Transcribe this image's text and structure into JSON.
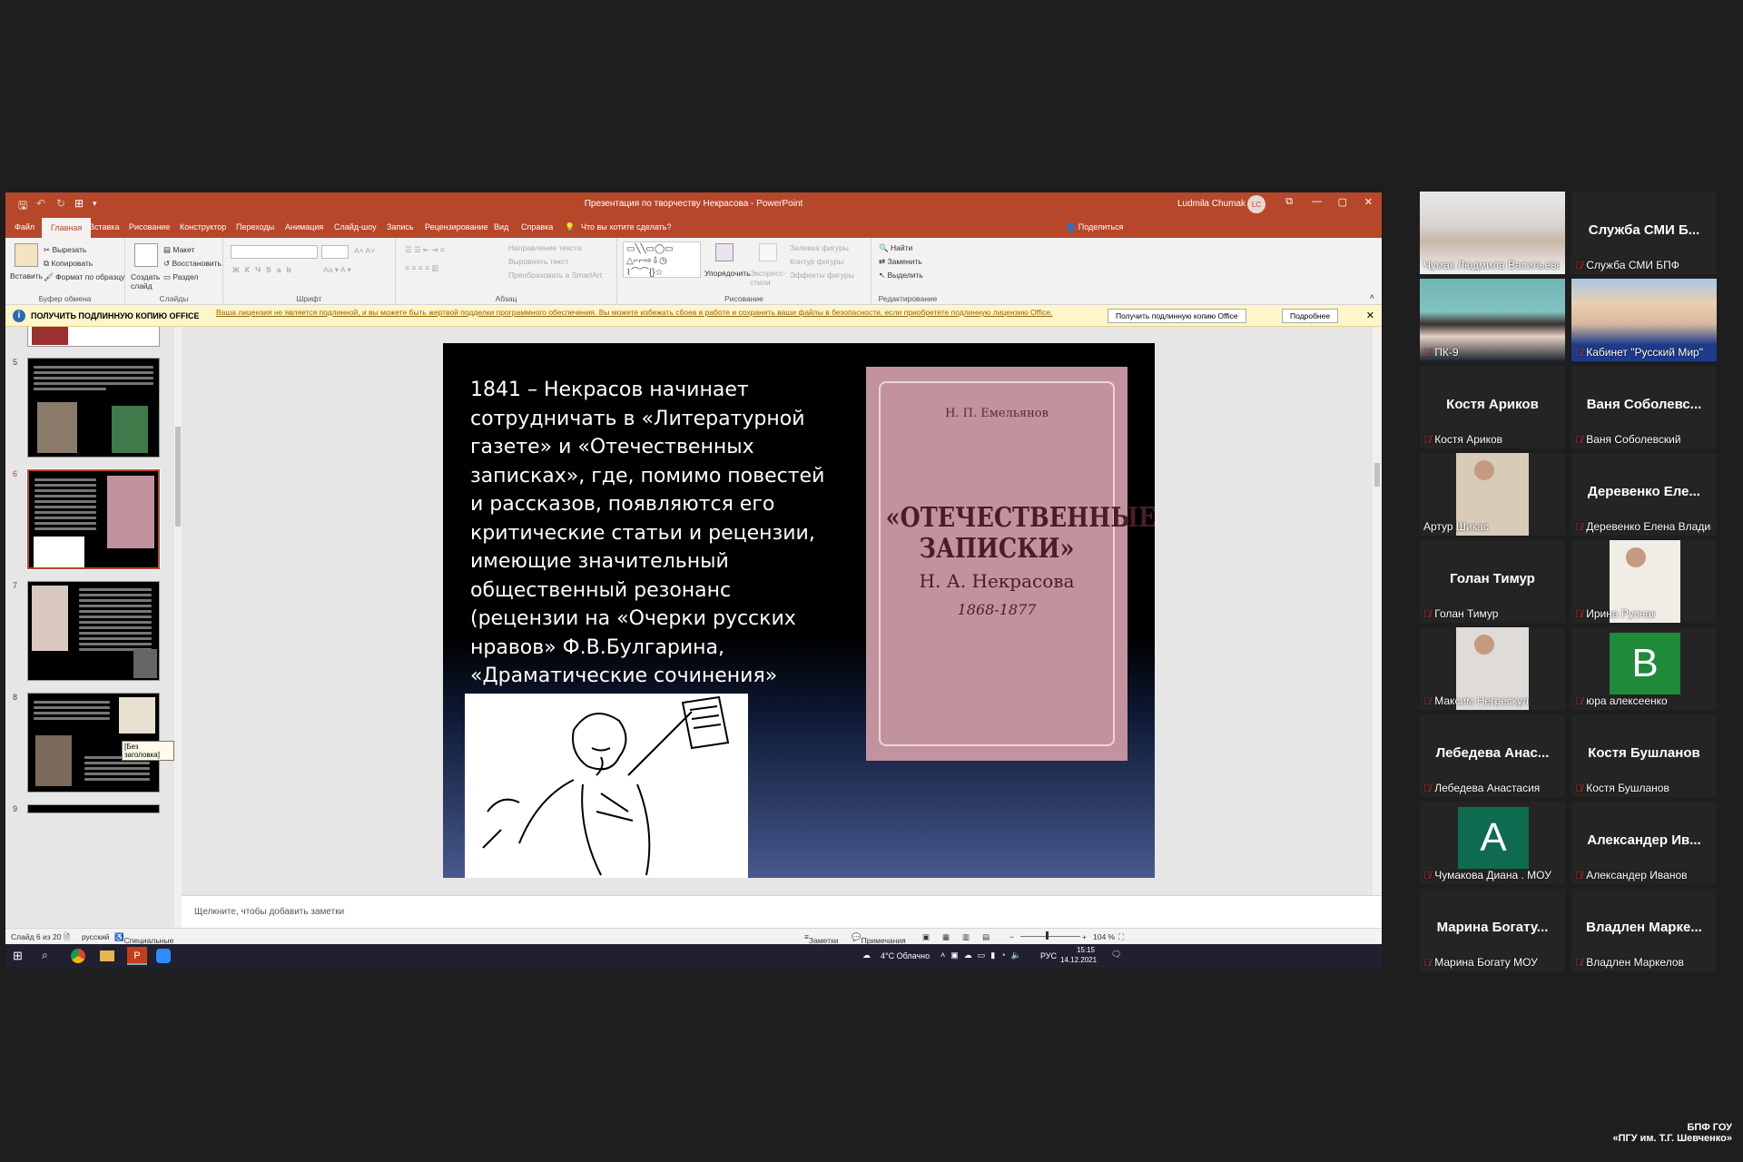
{
  "ppt": {
    "window_title": "Презентация по творчеству Некрасова - PowerPoint",
    "user_name": "Ludmila Chumak",
    "user_initials": "LC",
    "menu": [
      "Файл",
      "Главная",
      "Вставка",
      "Рисование",
      "Конструктор",
      "Переходы",
      "Анимация",
      "Слайд-шоу",
      "Запись",
      "Рецензирование",
      "Вид",
      "Справка"
    ],
    "tell_me": "Что вы хотите сделать?",
    "share": "Поделиться",
    "ribbon": {
      "clipboard": {
        "label": "Буфер обмена",
        "paste": "Вставить",
        "cut": "Вырезать",
        "copy": "Копировать",
        "format": "Формат по образцу"
      },
      "slides": {
        "label": "Слайды",
        "new": "Создать слайд",
        "layout": "Макет",
        "reset": "Восстановить",
        "section": "Раздел"
      },
      "font": {
        "label": "Шрифт"
      },
      "paragraph": {
        "label": "Абзац",
        "dir": "Направление текста",
        "align": "Выровнять текст",
        "smartart": "Преобразовать в SmartArt"
      },
      "drawing": {
        "label": "Рисование",
        "arrange": "Упорядочить",
        "styles": "Экспресс-стили",
        "fill": "Заливка фигуры",
        "outline": "Контур фигуры",
        "effects": "Эффекты фигуры"
      },
      "editing": {
        "label": "Редактирование",
        "find": "Найти",
        "replace": "Заменить",
        "select": "Выделить"
      }
    },
    "license": {
      "title": "ПОЛУЧИТЬ ПОДЛИННУЮ КОПИЮ OFFICE",
      "text": "Ваша лицензия не является подлинной, и вы можете быть жертвой подделки программного обеспечения. Вы можете избежать сбоев в работе и сохранить ваши файлы в безопасности, если приобретете подлинную лицензию Office.",
      "btn_get": "Получить подлинную копию Office",
      "btn_more": "Подробнее"
    },
    "thumb_numbers": [
      "5",
      "6",
      "7",
      "8",
      "9"
    ],
    "tooltip": "[Без заголовка]",
    "slide": {
      "text": "1841 – Некрасов начинает сотрудничать в «Литературной газете» и «Отечественных записках», где, помимо  повестей и рассказов, появляются его критические статьи и рецензии, имеющие значительный общественный резонанс (рецензии на «Очерки русских нравов» Ф.В.Булгарина, «Драматические сочинения» Н.Полевого).",
      "book_author": "Н. П. Емельянов",
      "book_title": "«ОТЕЧЕСТВЕННЫЕ ЗАПИСКИ»",
      "book_sub": "Н. А. Некрасова",
      "book_years": "1868-1877"
    },
    "notes_placeholder": "Щелкните, чтобы добавить заметки",
    "status": {
      "slide": "Слайд 6 из 20",
      "lang": "русский",
      "access": "Специальные возможности: проверьте рекомендации",
      "notes": "Заметки",
      "comments": "Примечания",
      "zoom": "104 %"
    },
    "taskbar": {
      "weather": "4°C  Облачно",
      "lang": "РУС",
      "time": "15:15",
      "date": "14.12.2021"
    }
  },
  "participants": [
    {
      "label": "Чумак Людмила Васильевна",
      "display": "",
      "video": "face1",
      "muted": false
    },
    {
      "label": "Служба СМИ БПФ",
      "display": "Служба СМИ Б...",
      "video": "",
      "muted": true
    },
    {
      "label": "ПК-9",
      "display": "",
      "video": "face2",
      "muted": true
    },
    {
      "label": "Кабинет \"Русский Мир\"",
      "display": "",
      "video": "face3",
      "muted": true
    },
    {
      "label": "Костя Ариков",
      "display": "Костя Ариков",
      "video": "",
      "muted": true
    },
    {
      "label": "Ваня Соболевский",
      "display": "Ваня Соболевс...",
      "video": "",
      "muted": true
    },
    {
      "label": "Артур Шикас",
      "display": "",
      "video": "face4",
      "muted": false,
      "active": true
    },
    {
      "label": "Деревенко Елена Владимировна",
      "display": "Деревенко Еле...",
      "video": "",
      "muted": true
    },
    {
      "label": "Голан Тимур",
      "display": "Голан Тимур",
      "video": "",
      "muted": true
    },
    {
      "label": "Ирина Руснак",
      "display": "",
      "video": "face5",
      "muted": true
    },
    {
      "label": "Максим Негрескул",
      "display": "",
      "video": "face6",
      "muted": true
    },
    {
      "label": "юра алексеенко",
      "display": "",
      "video": "letterB",
      "muted": true
    },
    {
      "label": "Лебедева Анастасия",
      "display": "Лебедева Анас...",
      "video": "",
      "muted": true
    },
    {
      "label": "Костя Бушланов",
      "display": "Костя Бушланов",
      "video": "",
      "muted": true
    },
    {
      "label": "Чумакова Диана . МОУ",
      "display": "",
      "video": "letterA",
      "muted": true
    },
    {
      "label": "Александер Иванов",
      "display": "Александер Ив...",
      "video": "",
      "muted": true
    },
    {
      "label": "Марина Богату МОУ",
      "display": "Марина Богату...",
      "video": "",
      "muted": true
    },
    {
      "label": "Владлен Маркелов",
      "display": "Владлен Марке...",
      "video": "",
      "muted": true
    }
  ],
  "letters": {
    "b": "B",
    "a": "A"
  },
  "watermark": [
    "БПФ ГОУ",
    "«ПГУ им. Т.Г. Шевченко»"
  ],
  "colors": {
    "ppt_accent": "#b7472a",
    "book": "#c2939e",
    "letterB": "#1e8a3a",
    "letterA": "#0f6b4f",
    "mute": "#e03030",
    "highlight": "#e5e55a"
  }
}
